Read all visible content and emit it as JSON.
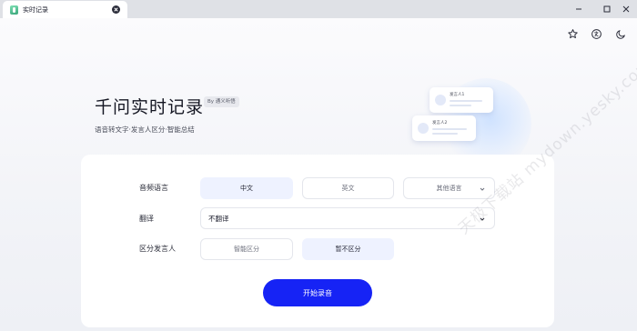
{
  "tab": {
    "title": "实时记录"
  },
  "hero": {
    "title": "千问实时记录",
    "badge": "By 通义听悟",
    "subtitle": "语音转文字·发言人区分·智能总结"
  },
  "illustration": {
    "card_top_name": "发言人1",
    "card_bottom_name": "发言人2"
  },
  "form": {
    "language_label": "音频语言",
    "language_options": [
      "中文",
      "英文",
      "其他语言"
    ],
    "language_selected": "中文",
    "translate_label": "翻译",
    "translate_value": "不翻译",
    "speaker_label": "区分发言人",
    "speaker_options": [
      "智能区分",
      "暂不区分"
    ],
    "speaker_selected": "暂不区分",
    "start_button": "开始录音"
  },
  "watermark": "天极下载站 mydown.yesky.com",
  "colors": {
    "accent": "#1623f5",
    "option_active_bg": "#eef2ff",
    "titlebar": "#dfe1e6"
  },
  "icons": [
    "close-icon",
    "minimize-icon",
    "maximize-icon",
    "star-icon",
    "translate-icon",
    "moon-icon",
    "chevron-down-icon",
    "user-icon"
  ]
}
